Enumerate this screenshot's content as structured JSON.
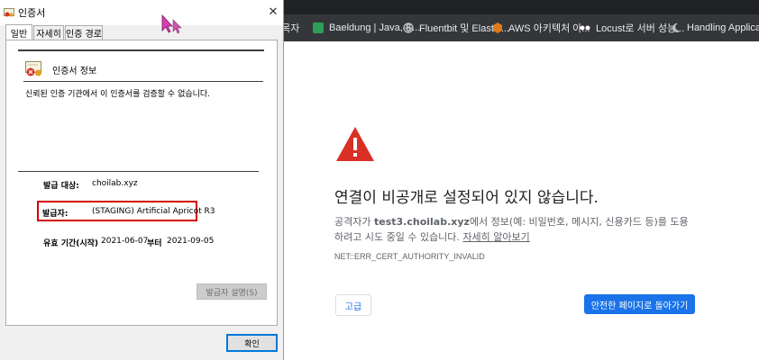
{
  "browser": {
    "bookmarks": [
      {
        "label": "깃목자",
        "icon": "bookmark-icon",
        "color": "#8ab4f8"
      },
      {
        "label": "Baeldung | Java, S...",
        "icon": "baeldung-icon",
        "color": "#2e9e58"
      },
      {
        "label": "Fluentbit 및 Elastic...",
        "icon": "globe-icon",
        "color": "#c5c7ca"
      },
      {
        "label": "AWS 아키텍처 아...",
        "icon": "aws-icon",
        "color": "#e07a1a"
      },
      {
        "label": "Locust로 서버 성능...",
        "icon": "locust-icon",
        "color": "#ffffff"
      },
      {
        "label": "Handling Applicati...",
        "icon": "moon-icon",
        "color": "#bdc1c6"
      }
    ],
    "error": {
      "title": "연결이 비공개로 설정되어 있지 않습니다.",
      "desc_prefix": "공격자가 ",
      "desc_host": "test3.choilab.xyz",
      "desc_middle": "에서 정보(예: 비밀번호, 메시지, 신용카드 등)를 도용하려고 시도 중일 수 있습니다. ",
      "desc_link": "자세히 알아보기",
      "code": "NET::ERR_CERT_AUTHORITY_INVALID",
      "advanced_label": "고급",
      "back_label": "안전한 페이지로 돌아가기",
      "warn_color": "#d93025",
      "primary_color": "#1a73e8"
    }
  },
  "dialog": {
    "title": "인증서",
    "close_glyph": "✕",
    "tabs": [
      {
        "label": "일반",
        "active": true
      },
      {
        "label": "자세히",
        "active": false
      },
      {
        "label": "인증 경로",
        "active": false
      }
    ],
    "info_heading": "인증서 정보",
    "info_text": "신뢰된 인증 기관에서 이 인증서를 검증할 수 없습니다.",
    "issued_to_label": "발급 대상:",
    "issued_to_value": "choilab.xyz",
    "issued_by_label": "발급자:",
    "issued_by_value": "(STAGING) Artificial Apricot R3",
    "validity_label": "유효 기간(시작)",
    "valid_from": "2021-06-07",
    "validity_to_label": "부터",
    "valid_to": "2021-09-05",
    "issuer_statement_label": "발급자 설명(S)",
    "ok_label": "확인",
    "highlight_color": "#d40000"
  }
}
